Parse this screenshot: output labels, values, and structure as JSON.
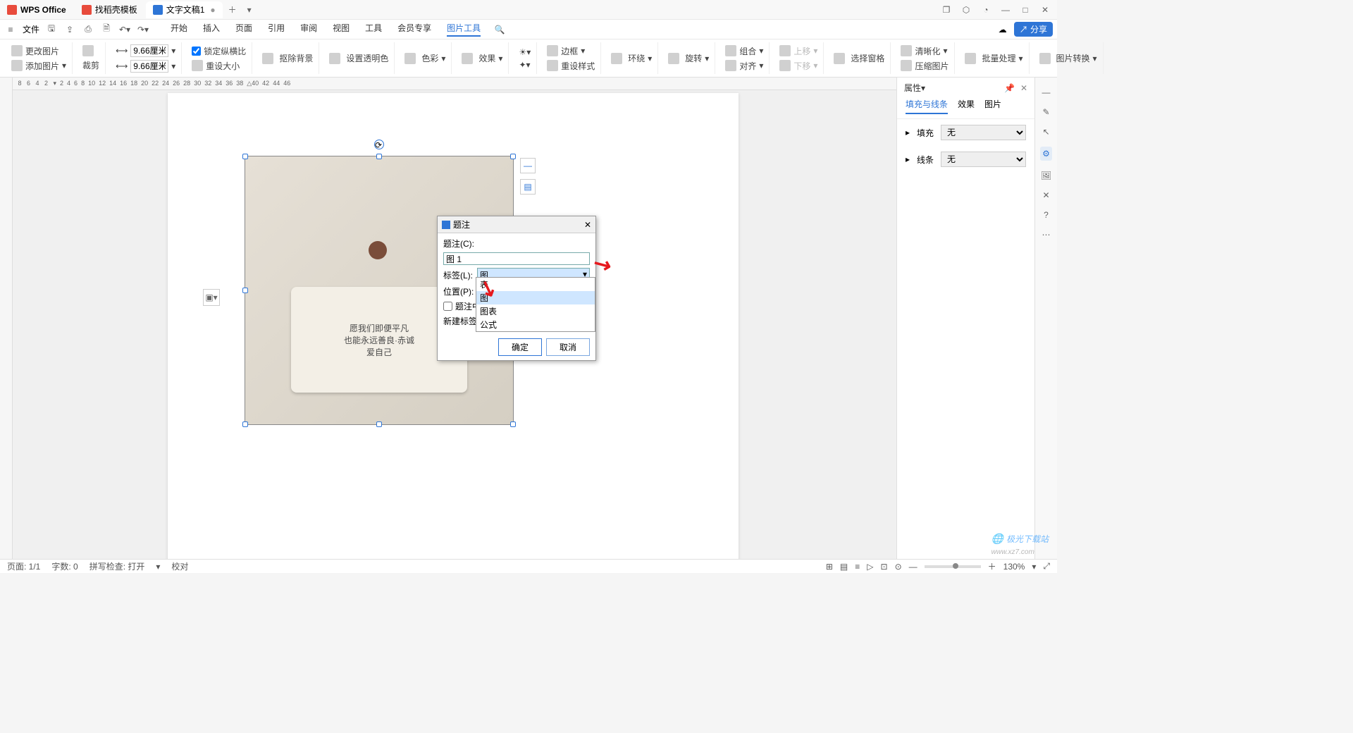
{
  "titlebar": {
    "app_name": "WPS Office",
    "tabs": [
      {
        "label": "找稻壳模板",
        "icon_color": "#e84b3c"
      },
      {
        "label": "文字文稿1",
        "icon_color": "#2e75d6",
        "active": true
      }
    ],
    "window_controls": [
      "❐",
      "⬡",
      "◔",
      "—",
      "□",
      "✕"
    ]
  },
  "menubar": {
    "file_label": "文件",
    "quick_icons": [
      "save",
      "export",
      "print",
      "print-preview",
      "undo",
      "redo"
    ],
    "tabs": [
      "开始",
      "插入",
      "页面",
      "引用",
      "审阅",
      "视图",
      "工具",
      "会员专享",
      "图片工具"
    ],
    "active_tab": "图片工具",
    "search_icon": "search",
    "cloud_icon": "☁",
    "share_label": "分享"
  },
  "ribbon": {
    "change_pic": "更改图片",
    "add_pic": "添加图片",
    "crop": "裁剪",
    "width": "9.66厘米",
    "height": "9.66厘米",
    "lock_ratio": "锁定纵横比",
    "reset_size": "重设大小",
    "remove_bg": "抠除背景",
    "set_transparent": "设置透明色",
    "color": "色彩",
    "effect": "效果",
    "brightness": "☀",
    "sharpen": "✦",
    "border": "边框",
    "reset_style": "重设样式",
    "wrap": "环绕",
    "rotate": "旋转",
    "combine": "组合",
    "align": "对齐",
    "up": "上移",
    "down": "下移",
    "sel_pane": "选择窗格",
    "clarity": "清晰化",
    "compress": "压缩图片",
    "batch": "批量处理",
    "convert": "图片转换"
  },
  "page_image": {
    "line1": "愿我们即便平凡",
    "line2": "也能永远善良·赤诚",
    "line3": "爱自己"
  },
  "dialog": {
    "title": "题注",
    "caption_label": "题注(C):",
    "caption_value": "图 1",
    "tag_label": "标签(L):",
    "tag_value": "图",
    "pos_label": "位置(P):",
    "chk_label": "题注中",
    "new_label": "新建标签",
    "list": [
      "表",
      "图",
      "图表",
      "公式"
    ],
    "ok": "确定",
    "cancel": "取消"
  },
  "right_panel": {
    "header": "属性",
    "tabs": [
      "填充与线条",
      "效果",
      "图片"
    ],
    "fill_label": "填充",
    "fill_value": "无",
    "line_label": "线条",
    "line_value": "无"
  },
  "statusbar": {
    "page": "页面: 1/1",
    "words": "字数: 0",
    "spell": "拼写检查: 打开",
    "proof": "校对",
    "zoom": "130%"
  },
  "watermark": "极光下载站"
}
